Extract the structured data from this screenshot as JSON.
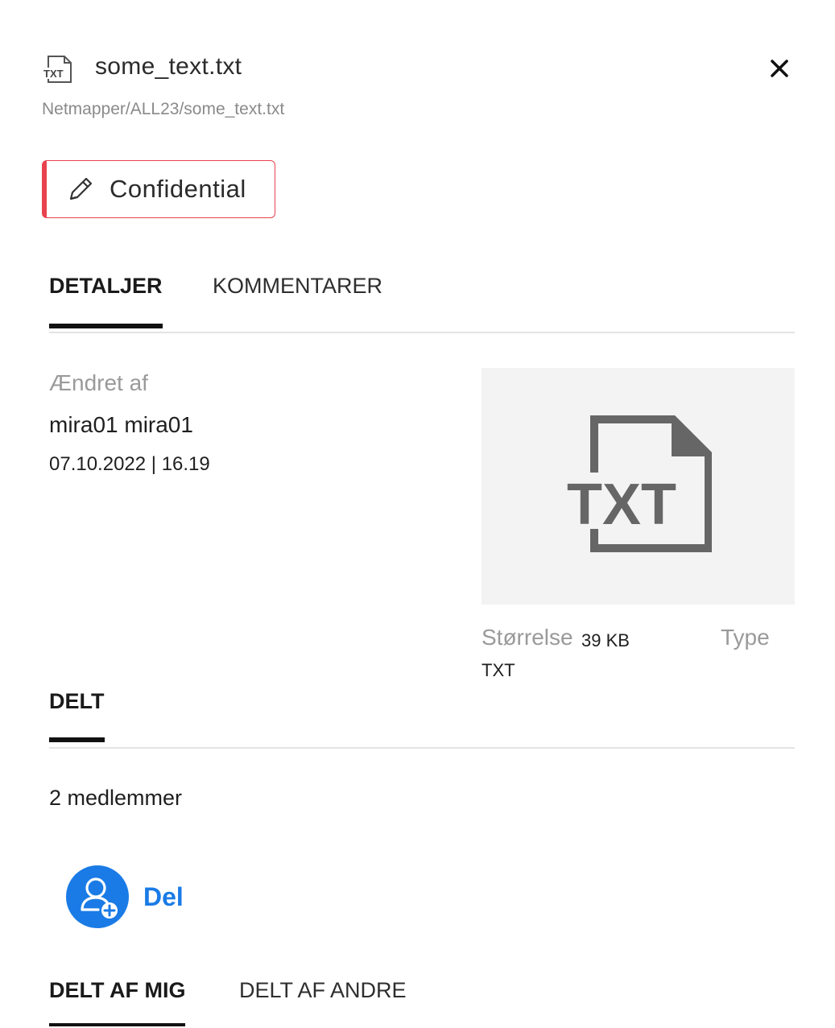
{
  "header": {
    "file_icon_text": "TXT",
    "title": "some_text.txt",
    "path": "Netmapper/ALL23/some_text.txt",
    "close_icon": "close-icon"
  },
  "classification": {
    "label": "Confidential",
    "color": "#e8424e",
    "icon": "pencil-icon"
  },
  "detail_tabs": [
    {
      "label": "DETALJER",
      "active": true
    },
    {
      "label": "KOMMENTARER",
      "active": false
    }
  ],
  "details": {
    "modified_label": "Ændret af",
    "modified_user": "mira01 mira01",
    "modified_date": "07.10.2022 | 16.19",
    "preview_text": "TXT",
    "size_label": "Størrelse",
    "size_value": "39 KB",
    "type_label": "Type",
    "type_value": "TXT"
  },
  "shared_section": {
    "heading": "DELT",
    "members": "2 medlemmer",
    "share_label": "Del",
    "share_color": "#1a7be6",
    "share_icon": "add-user-icon"
  },
  "shared_tabs": [
    {
      "label": "DELT AF MIG",
      "active": true
    },
    {
      "label": "DELT AF ANDRE",
      "active": false
    }
  ]
}
